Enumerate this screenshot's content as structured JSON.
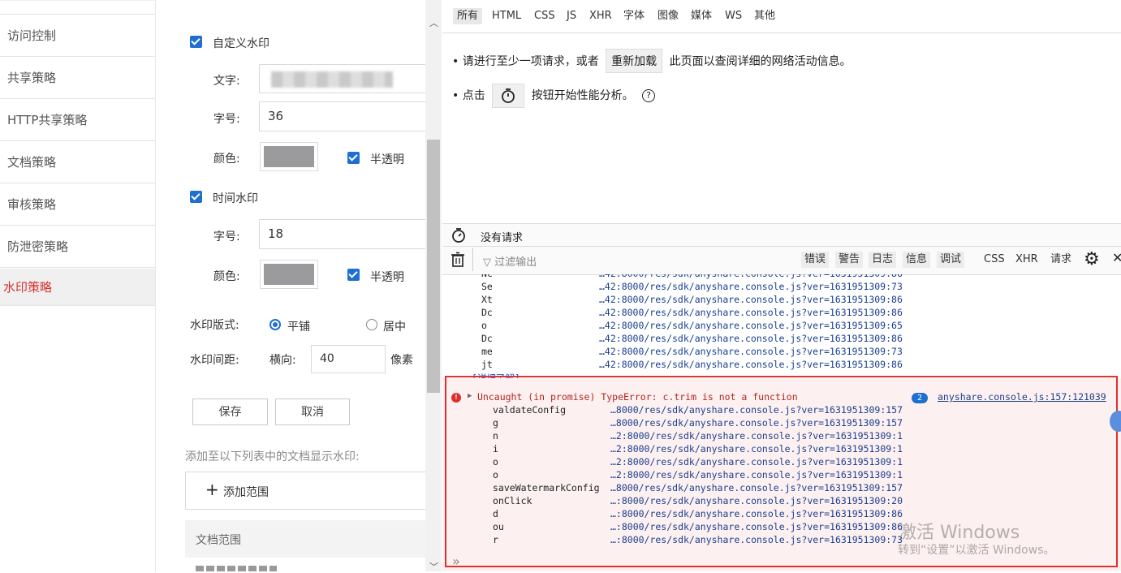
{
  "sidebar": {
    "items": [
      {
        "label": "访问控制"
      },
      {
        "label": "共享策略"
      },
      {
        "label": "HTTP共享策略"
      },
      {
        "label": "文档策略"
      },
      {
        "label": "审核策略"
      },
      {
        "label": "防泄密策略"
      },
      {
        "label": "水印策略",
        "active": true
      }
    ]
  },
  "form": {
    "custom_watermark_label": "自定义水印",
    "text_label": "文字:",
    "font_size_label": "字号:",
    "font_size_value": "36",
    "color_label": "颜色:",
    "translucent_label": "半透明",
    "time_watermark_label": "时间水印",
    "time_font_size_label": "字号:",
    "time_font_size_value": "18",
    "time_color_label": "颜色:",
    "time_translucent_label": "半透明",
    "layout_label": "水印版式:",
    "layout_tile": "平铺",
    "layout_center": "居中",
    "spacing_label": "水印间距:",
    "horizontal_label": "横向:",
    "horizontal_value": "40",
    "unit_label": "像素",
    "save": "保存",
    "cancel": "取消",
    "list_hint": "添加至以下列表中的文档显示水印:",
    "add_scope": "添加范围",
    "scope_header": "文档范围",
    "swatch_color": "#9b9a9c"
  },
  "devtools": {
    "filter_tabs": [
      "所有",
      "HTML",
      "CSS",
      "JS",
      "XHR",
      "字体",
      "图像",
      "媒体",
      "WS",
      "其他"
    ],
    "hint1_prefix": "请进行至少一项请求，或者",
    "reload_button": "重新加载",
    "hint1_suffix": "此页面以查阅详细的网络活动信息。",
    "hint2_prefix": "点击",
    "hint2_suffix": "按钮开始性能分析。",
    "no_requests": "没有请求",
    "console_filter_placeholder": "过滤输出",
    "level_buttons": [
      "错误",
      "警告",
      "日志",
      "信息",
      "调试"
    ],
    "type_links": [
      "CSS",
      "XHR",
      "请求"
    ],
    "stack_before": [
      {
        "fn": "Se",
        "url": "…42:8000/res/sdk/anyshare.console.js?ver=1631951309:73"
      },
      {
        "fn": "Xt",
        "url": "…42:8000/res/sdk/anyshare.console.js?ver=1631951309:86"
      },
      {
        "fn": "Dc",
        "url": "…42:8000/res/sdk/anyshare.console.js?ver=1631951309:86"
      },
      {
        "fn": "o",
        "url": "…42:8000/res/sdk/anyshare.console.js?ver=1631951309:65"
      },
      {
        "fn": "Dc",
        "url": "…42:8000/res/sdk/anyshare.console.js?ver=1631951309:86"
      },
      {
        "fn": "me",
        "url": "…42:8000/res/sdk/anyshare.console.js?ver=1631951309:73"
      },
      {
        "fn": "jt",
        "url": "…42:8000/res/sdk/anyshare.console.js?ver=1631951309:86"
      }
    ],
    "learn_more": "[详细了解]",
    "error_message": "Uncaught (in promise) TypeError: c.trim is not a function",
    "error_count": "2",
    "error_source": "anyshare.console.js:157:121039",
    "error_stack": [
      {
        "fn": "valdateConfig",
        "url": "…8000/res/sdk/anyshare.console.js?ver=1631951309:157"
      },
      {
        "fn": "g",
        "url": "…8000/res/sdk/anyshare.console.js?ver=1631951309:157"
      },
      {
        "fn": "n",
        "url": "…2:8000/res/sdk/anyshare.console.js?ver=1631951309:1"
      },
      {
        "fn": "i",
        "url": "…2:8000/res/sdk/anyshare.console.js?ver=1631951309:1"
      },
      {
        "fn": "o",
        "url": "…2:8000/res/sdk/anyshare.console.js?ver=1631951309:1"
      },
      {
        "fn": "o",
        "url": "…2:8000/res/sdk/anyshare.console.js?ver=1631951309:1"
      },
      {
        "fn": "saveWatermarkConfig",
        "url": "…8000/res/sdk/anyshare.console.js?ver=1631951309:157"
      },
      {
        "fn": "onClick",
        "url": "…:8000/res/sdk/anyshare.console.js?ver=1631951309:20"
      },
      {
        "fn": "d",
        "url": "…:8000/res/sdk/anyshare.console.js?ver=1631951309:86"
      },
      {
        "fn": "ou",
        "url": "…:8000/res/sdk/anyshare.console.js?ver=1631951309:86"
      },
      {
        "fn": "r",
        "url": "…:8000/res/sdk/anyshare.console.js?ver=1631951309:73"
      }
    ],
    "prompt_symbol": "»"
  },
  "watermark": {
    "line1": "激活 Windows",
    "line2": "转到“设置”以激活 Windows。"
  },
  "colors": {
    "accent": "#d9302c",
    "primary": "#1f6fd1",
    "error_box": "#e03030"
  }
}
